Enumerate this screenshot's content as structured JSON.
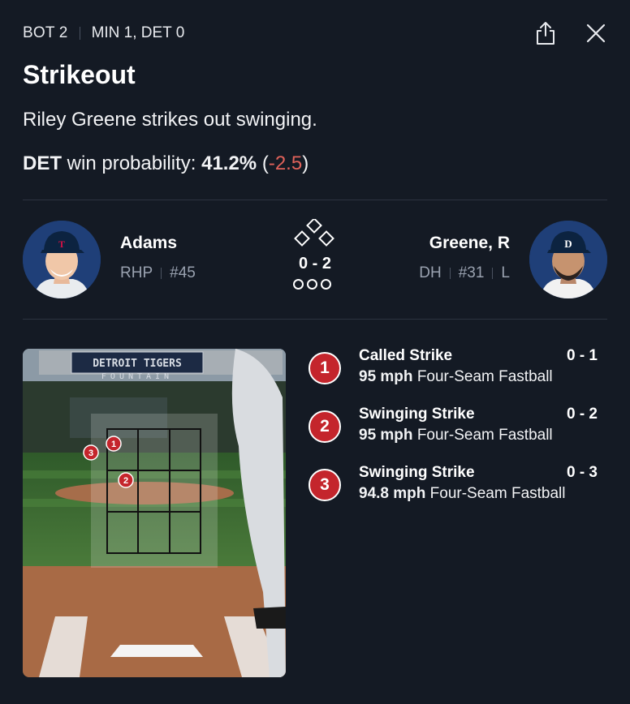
{
  "header": {
    "inning": "BOT 2",
    "score": "MIN 1, DET 0",
    "share_icon": "share-icon",
    "close_icon": "close-icon"
  },
  "play": {
    "title": "Strikeout",
    "description": "Riley Greene strikes out swinging."
  },
  "win_probability": {
    "team": "DET",
    "label": "win probability:",
    "value": "41.2%",
    "open": "(",
    "delta": "-2.5",
    "close": ")"
  },
  "matchup": {
    "pitcher": {
      "name": "Adams",
      "throws": "RHP",
      "number": "#45",
      "cap_color": "#0c2340"
    },
    "batter": {
      "name": "Greene, R",
      "position": "DH",
      "number": "#31",
      "bats": "L",
      "cap_color": "#0c2340"
    },
    "count": "0 - 2",
    "outs_shown": 3,
    "bases_icon": "bases-diamond-icon"
  },
  "zone": {
    "banner_line1": "DETROIT TIGERS",
    "banner_line2": "FOUNTAIN",
    "markers": [
      "1",
      "2",
      "3"
    ]
  },
  "pitches": [
    {
      "number": "1",
      "result": "Called Strike",
      "count": "0 - 1",
      "speed": "95 mph",
      "type": "Four-Seam Fastball"
    },
    {
      "number": "2",
      "result": "Swinging Strike",
      "count": "0 - 2",
      "speed": "95 mph",
      "type": "Four-Seam Fastball"
    },
    {
      "number": "3",
      "result": "Swinging Strike",
      "count": "0 - 3",
      "speed": "94.8 mph",
      "type": "Four-Seam Fastball"
    }
  ],
  "colors": {
    "background": "#141a24",
    "pitch_marker": "#c4252c",
    "negative_delta": "#e0625a"
  }
}
